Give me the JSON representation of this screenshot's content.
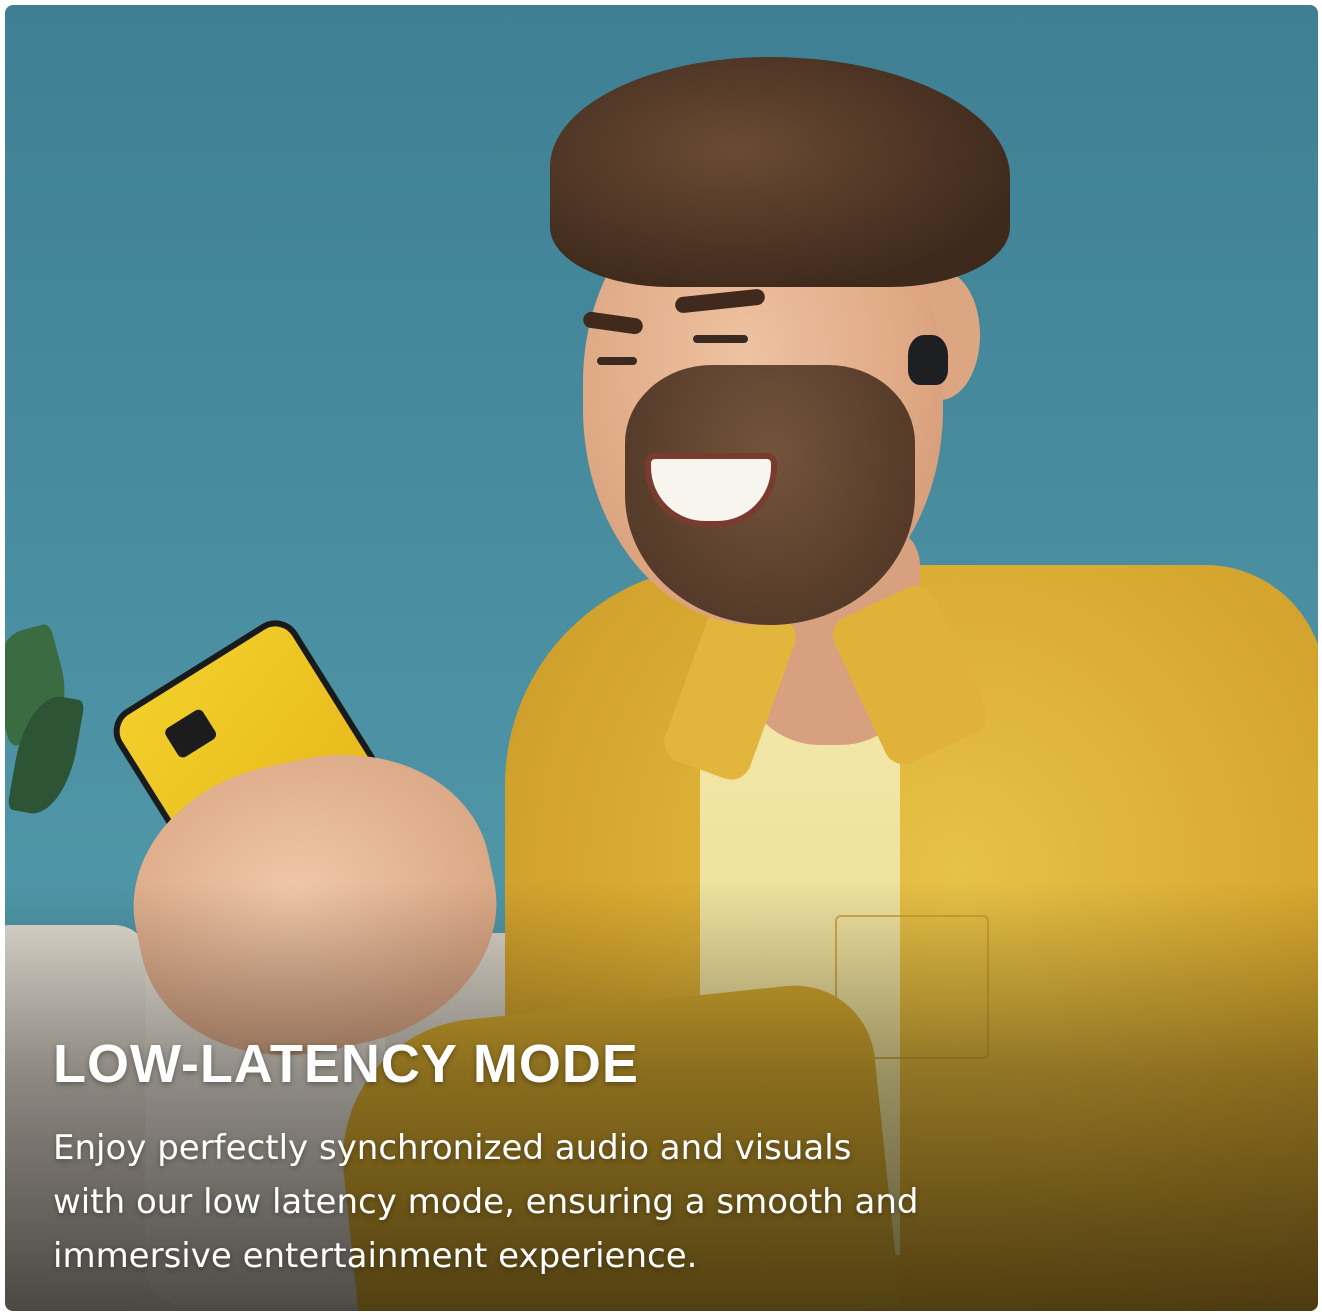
{
  "feature": {
    "title": "LOW-LATENCY MODE",
    "description": "Enjoy perfectly synchronized audio and visuals with our low latency mode, ensuring a smooth and immersive entertainment experience."
  },
  "colors": {
    "background_wall": "#4a8ea1",
    "shirt": "#d8a92f",
    "text": "#ffffff"
  }
}
